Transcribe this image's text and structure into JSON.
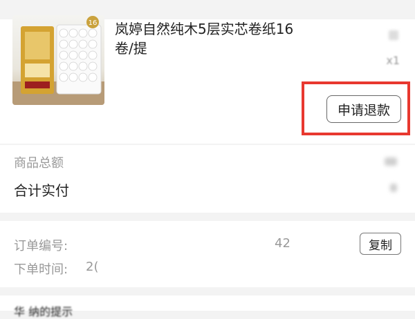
{
  "product": {
    "title": "岚婷自然纯木5层实芯卷纸16卷/提",
    "quantity": "x1",
    "refund_label": "申请退款",
    "highlight_color": "#e8382f"
  },
  "amounts": {
    "total_label": "商品总额",
    "paid_label": "合计实付"
  },
  "order": {
    "number_label": "订单编号:",
    "number_value": "42",
    "time_label": "下单时间:",
    "time_value": "2(",
    "copy_label": "复制"
  },
  "bottom": {
    "text": "华 纳的提示"
  }
}
